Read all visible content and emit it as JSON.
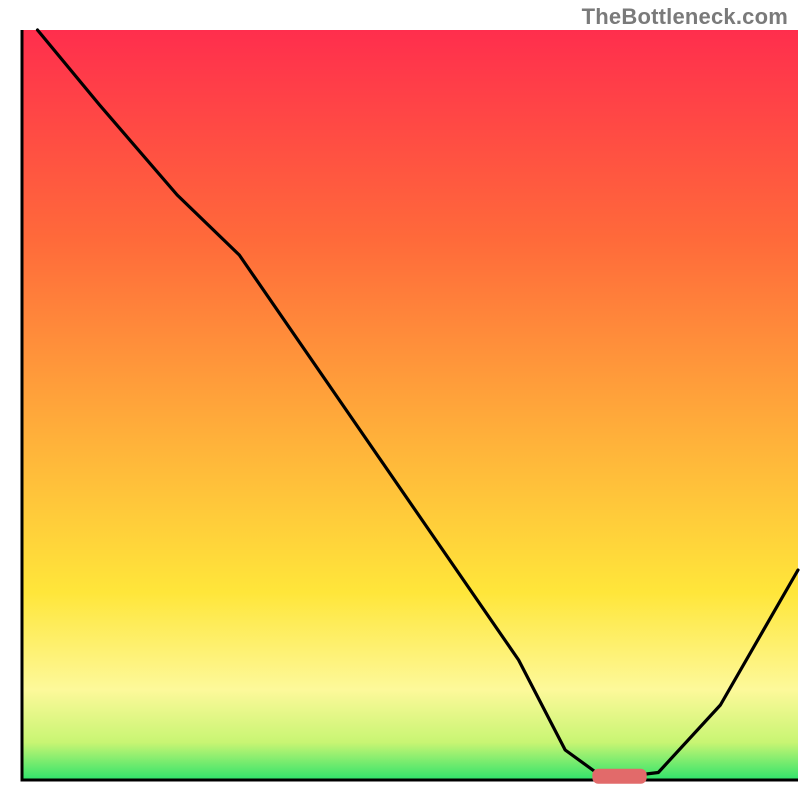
{
  "watermark": "TheBottleneck.com",
  "chart_data": {
    "type": "line",
    "title": "",
    "xlabel": "",
    "ylabel": "",
    "xlim": [
      0,
      100
    ],
    "ylim": [
      0,
      100
    ],
    "gradient_stops": [
      {
        "offset": 0,
        "color": "#ff2e4d"
      },
      {
        "offset": 28,
        "color": "#ff6a3a"
      },
      {
        "offset": 55,
        "color": "#ffb23a"
      },
      {
        "offset": 75,
        "color": "#ffe63a"
      },
      {
        "offset": 88,
        "color": "#fdf99a"
      },
      {
        "offset": 95,
        "color": "#c8f573"
      },
      {
        "offset": 100,
        "color": "#2fe36b"
      }
    ],
    "series": [
      {
        "name": "bottleneck-curve",
        "color": "#000000",
        "x": [
          2,
          10,
          20,
          28,
          40,
          52,
          64,
          70,
          74,
          78,
          82,
          90,
          100
        ],
        "y": [
          100,
          90,
          78,
          70,
          52,
          34,
          16,
          4,
          1,
          0.5,
          1,
          10,
          28
        ]
      }
    ],
    "marker": {
      "name": "optimal-range",
      "x_center": 77,
      "y": 0.5,
      "width": 7,
      "height": 2,
      "fill": "#e26a6a"
    },
    "axes": {
      "stroke": "#000000",
      "stroke_width": 3,
      "left_x": 2,
      "bottom_y": 0
    }
  }
}
